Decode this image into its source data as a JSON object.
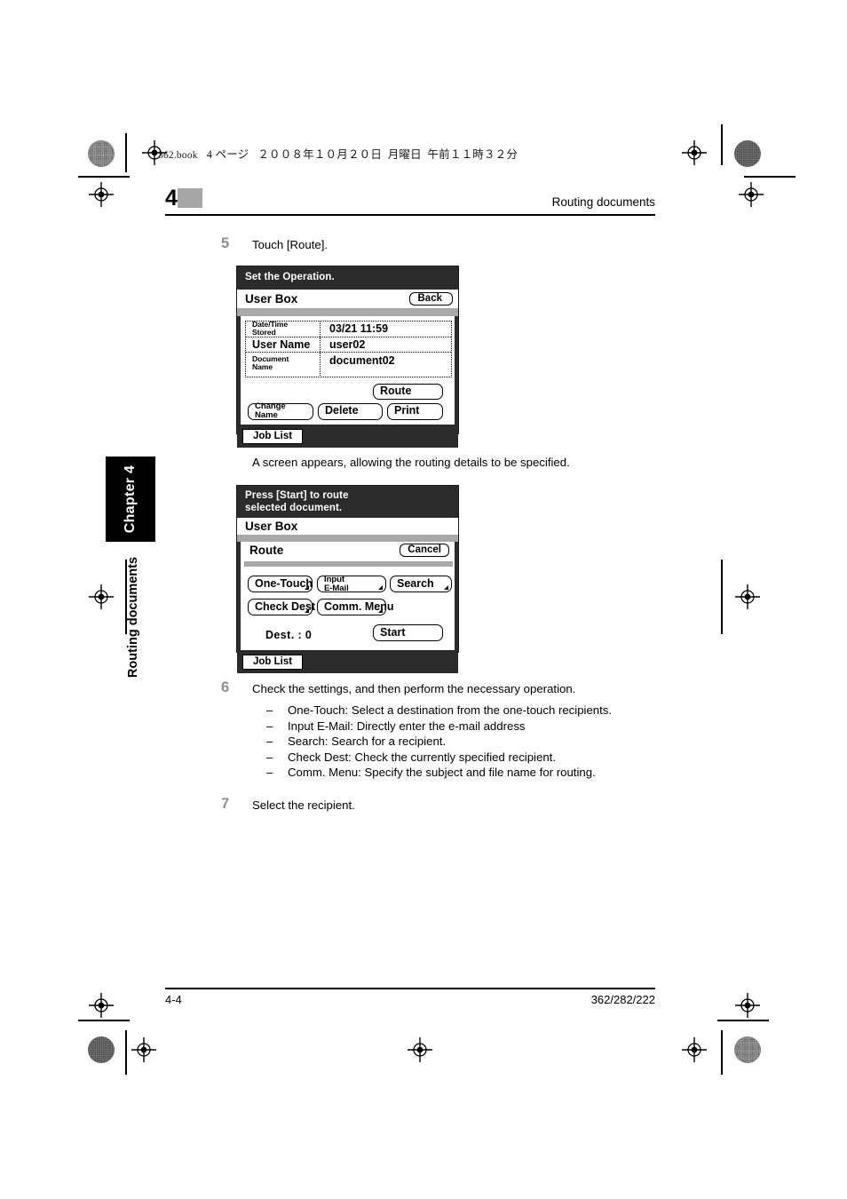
{
  "print_banner": {
    "book_name": "362.book",
    "page_label": "4 ページ",
    "date": "２００８年１０月２０日",
    "weekday": "月曜日",
    "time": "午前１１時３２分"
  },
  "header": {
    "chapter_number": "4",
    "title": "Routing documents"
  },
  "side_tab": {
    "chapter_label": "Chapter 4",
    "section_label": "Routing documents"
  },
  "steps": [
    {
      "number": "5",
      "text": "Touch [Route]."
    },
    {
      "number": "6",
      "text": "Check the settings, and then perform the necessary operation."
    },
    {
      "number": "7",
      "text": "Select the recipient."
    }
  ],
  "note_text": "A screen appears, allowing the routing details to be specified.",
  "bullets": [
    {
      "dash": "–",
      "text": "One-Touch: Select a destination from the one-touch recipients."
    },
    {
      "dash": "–",
      "text": "Input E-Mail: Directly enter the e-mail address"
    },
    {
      "dash": "–",
      "text": "Search: Search for a recipient."
    },
    {
      "dash": "–",
      "text": "Check Dest: Check the currently specified recipient."
    },
    {
      "dash": "–",
      "text": "Comm. Menu: Specify the subject and file name for routing."
    }
  ],
  "panel1": {
    "title": "Set the Operation.",
    "subtitle": "User Box",
    "back_label": "Back",
    "table": [
      {
        "label_line1": "Date/Time",
        "label_line2": "Stored",
        "value": "03/21  11:59"
      },
      {
        "label_line1": "User Name",
        "label_line2": "",
        "value": "user02"
      },
      {
        "label_line1": "Document",
        "label_line2": "Name",
        "value": "document02"
      }
    ],
    "route_label": "Route",
    "change_name_line1": "Change",
    "change_name_line2": "Name",
    "delete_label": "Delete",
    "print_label": "Print",
    "job_list_label": "Job List"
  },
  "panel2": {
    "title_line1": "Press [Start] to route",
    "title_line2": "selected document.",
    "subtitle": "User Box",
    "route_label": "Route",
    "cancel_label": "Cancel",
    "buttons_row1": [
      {
        "label": "One-Touch",
        "line1": "",
        "line2": ""
      },
      {
        "label": "",
        "line1": "Input",
        "line2": "E-Mail"
      },
      {
        "label": "Search",
        "line1": "",
        "line2": ""
      }
    ],
    "buttons_row2": [
      {
        "label": "Check Dest"
      },
      {
        "label": "Comm. Menu"
      }
    ],
    "dest_label": "Dest.  :   0",
    "start_label": "Start",
    "job_list_label": "Job List"
  },
  "footer": {
    "page_number": "4-4",
    "model_numbers": "362/282/222"
  },
  "colors": {
    "lcd_frame": "#2b2b2b",
    "lcd_grey_bar": "#a8a8a8",
    "header_swatch": "#a6a6a6",
    "step_number": "#8e8e8e"
  }
}
